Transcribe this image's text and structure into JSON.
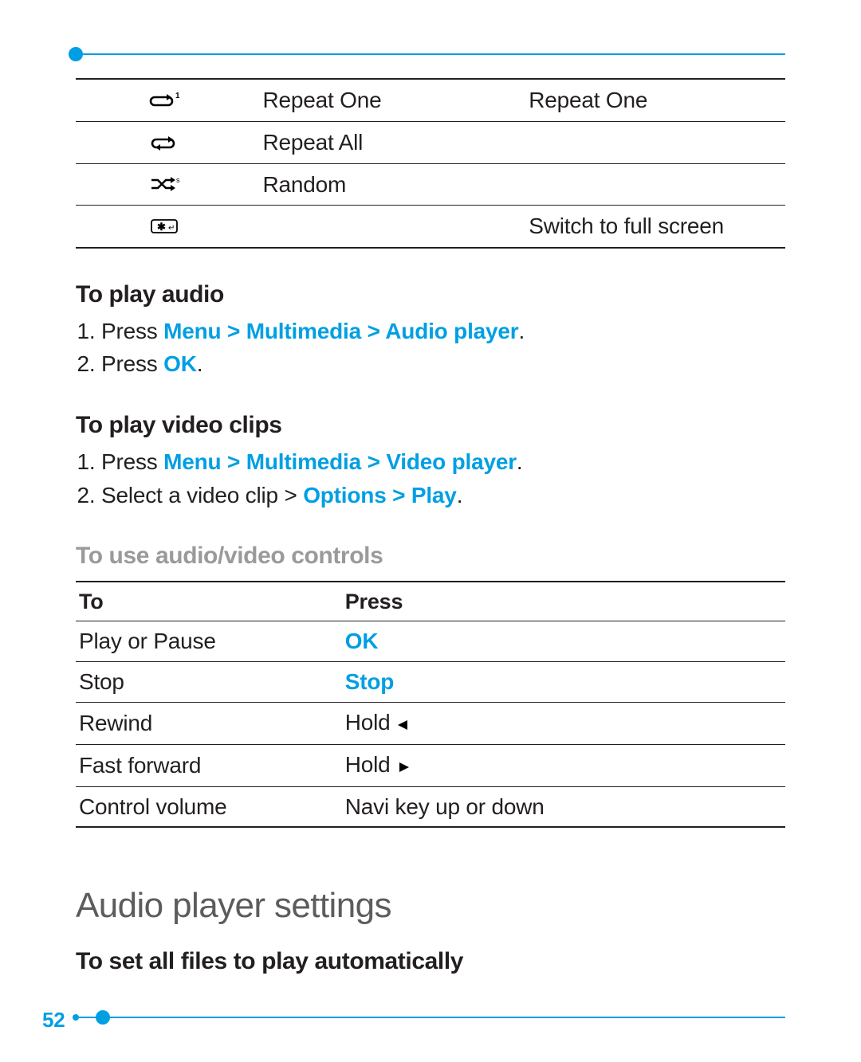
{
  "accent_color": "#009fe3",
  "page_number": "52",
  "icons_table": {
    "rows": [
      {
        "icon_name": "repeat-one-icon",
        "label": "Repeat One",
        "extra": "Repeat One"
      },
      {
        "icon_name": "repeat-all-icon",
        "label": "Repeat All",
        "extra": ""
      },
      {
        "icon_name": "random-icon",
        "label": "Random",
        "extra": ""
      },
      {
        "icon_name": "star-key-icon",
        "label": "",
        "extra": "Switch to full screen"
      }
    ]
  },
  "sections": {
    "play_audio": {
      "heading": "To play audio",
      "steps": [
        {
          "prefix": "Press ",
          "path": "Menu > Multimedia > Audio player",
          "suffix": "."
        },
        {
          "prefix": "Press ",
          "path": "OK",
          "suffix": "."
        }
      ]
    },
    "play_video": {
      "heading": "To play video clips",
      "steps": [
        {
          "prefix": "Press ",
          "path": "Menu > Multimedia > Video player",
          "suffix": "."
        },
        {
          "prefix": "Select a video clip > ",
          "path": "Options > Play",
          "suffix": "."
        }
      ]
    },
    "controls": {
      "heading": "To use audio/video controls",
      "header_to": "To",
      "header_press": "Press",
      "rows": [
        {
          "to": "Play or Pause",
          "press": {
            "kw": "OK"
          }
        },
        {
          "to": "Stop",
          "press": {
            "kw": "Stop"
          }
        },
        {
          "to": "Rewind",
          "press": {
            "text_before": "Hold ",
            "glyph": "left"
          }
        },
        {
          "to": "Fast forward",
          "press": {
            "text_before": "Hold ",
            "glyph": "right"
          }
        },
        {
          "to": "Control volume",
          "press": {
            "text": "Navi key up or down"
          }
        }
      ]
    }
  },
  "main_heading": "Audio player settings",
  "sub_heading_autoplay": "To set all files to play automatically"
}
